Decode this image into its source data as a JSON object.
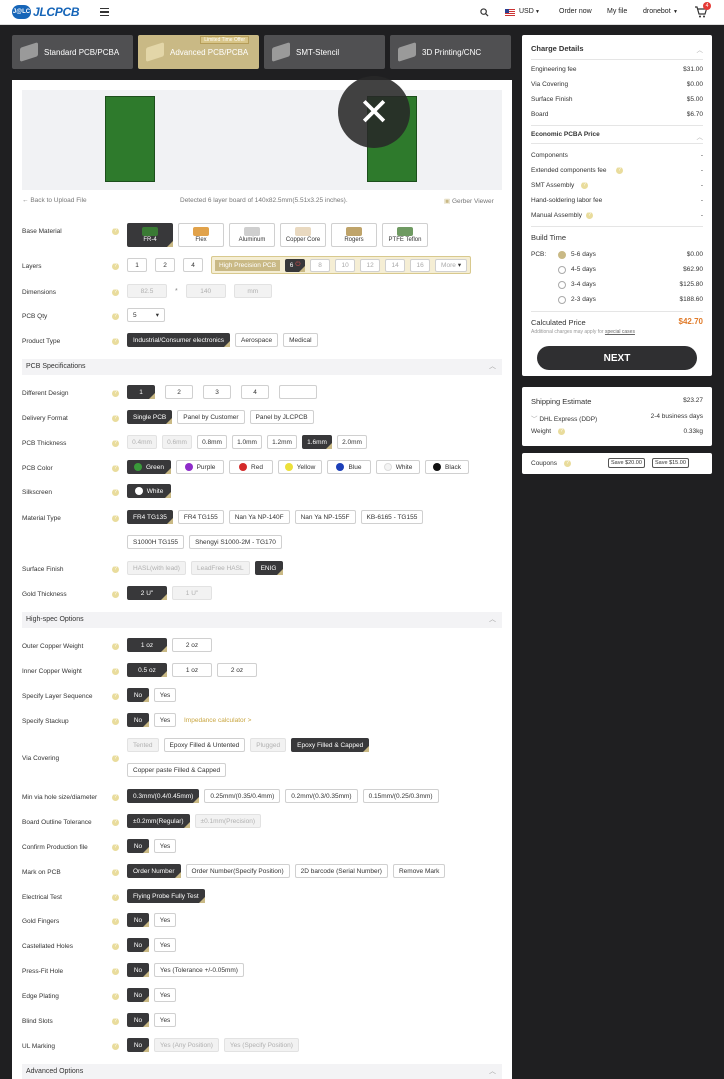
{
  "header": {
    "logo_badge": "J@LC",
    "logo_text": "JLCPCB",
    "currency": "USD",
    "order_now": "Order now",
    "my_file": "My file",
    "user": "dronebot",
    "cart_count": "4"
  },
  "tabs": [
    {
      "label": "Standard PCB/PCBA"
    },
    {
      "label": "Advanced PCB/PCBA",
      "badge": "Limited Time Offer"
    },
    {
      "label": "SMT-Stencil"
    },
    {
      "label": "3D Printing/CNC"
    }
  ],
  "preview": {
    "back": "Back to Upload File",
    "detected": "Detected 6 layer board of 140x82.5mm(5.51x3.25 inches).",
    "gerber": "Gerber Viewer",
    "close": "✕"
  },
  "base_material": {
    "label": "Base Material",
    "options": [
      "FR-4",
      "Flex",
      "Aluminum",
      "Copper Core",
      "Rogers",
      "PTFE Teflon"
    ]
  },
  "layers": {
    "label": "Layers",
    "options": [
      "1",
      "2",
      "4"
    ],
    "hp_label": "High Precision PCB",
    "hp_options": [
      "6",
      "8",
      "10",
      "12",
      "14",
      "16"
    ],
    "more": "More"
  },
  "dimensions": {
    "label": "Dimensions",
    "w": "82.5",
    "x": "*",
    "h": "140",
    "unit": "mm"
  },
  "pcb_qty": {
    "label": "PCB Qty",
    "value": "5"
  },
  "product_type": {
    "label": "Product Type",
    "options": [
      "Industrial/Consumer electronics",
      "Aerospace",
      "Medical"
    ]
  },
  "specs_section": "PCB Specifications",
  "different_design": {
    "label": "Different Design",
    "options": [
      "1",
      "2",
      "3",
      "4",
      ""
    ]
  },
  "delivery_format": {
    "label": "Delivery Format",
    "options": [
      "Single PCB",
      "Panel by Customer",
      "Panel by JLCPCB"
    ]
  },
  "pcb_thickness": {
    "label": "PCB Thickness",
    "options": [
      "0.4mm",
      "0.6mm",
      "0.8mm",
      "1.0mm",
      "1.2mm",
      "1.6mm",
      "2.0mm"
    ]
  },
  "pcb_color": {
    "label": "PCB Color",
    "options": [
      {
        "name": "Green",
        "color": "#3a9a3a"
      },
      {
        "name": "Purple",
        "color": "#8e2cc9"
      },
      {
        "name": "Red",
        "color": "#d42a2a"
      },
      {
        "name": "Yellow",
        "color": "#ece03a"
      },
      {
        "name": "Blue",
        "color": "#1c3fb8"
      },
      {
        "name": "White",
        "color": "#f4f4f4"
      },
      {
        "name": "Black",
        "color": "#111111"
      }
    ]
  },
  "silkscreen": {
    "label": "Silkscreen",
    "value": "White"
  },
  "material_type": {
    "label": "Material Type",
    "options": [
      "FR4 TG135",
      "FR4 TG155",
      "Nan Ya NP-140F",
      "Nan Ya NP-155F",
      "KB-6165 - TG155",
      "S1000H TG155",
      "Shengyi S1000-2M - TG170"
    ]
  },
  "surface_finish": {
    "label": "Surface Finish",
    "options": [
      "HASL(with lead)",
      "LeadFree HASL",
      "ENIG"
    ]
  },
  "gold_thickness": {
    "label": "Gold Thickness",
    "options": [
      "2 U\"",
      "1 U\""
    ]
  },
  "highspec_section": "High-spec Options",
  "outer_copper": {
    "label": "Outer Copper Weight",
    "options": [
      "1 oz",
      "2 oz"
    ]
  },
  "inner_copper": {
    "label": "Inner Copper Weight",
    "options": [
      "0.5 oz",
      "1 oz",
      "2 oz"
    ]
  },
  "layer_sequence": {
    "label": "Specify Layer Sequence",
    "options": [
      "No",
      "Yes"
    ]
  },
  "stackup": {
    "label": "Specify Stackup",
    "options": [
      "No",
      "Yes"
    ],
    "link": "Impedance calculator >"
  },
  "via_covering": {
    "label": "Via Covering",
    "options": [
      "Tented",
      "Epoxy Filled & Untented",
      "Plugged",
      "Epoxy Filled & Capped",
      "Copper paste Filled & Capped"
    ]
  },
  "min_via": {
    "label": "Min via hole size/diameter",
    "options": [
      "0.3mm/(0.4/0.45mm)",
      "0.25mm/(0.35/0.4mm)",
      "0.2mm/(0.3/0.35mm)",
      "0.15mm/(0.25/0.3mm)"
    ]
  },
  "outline_tol": {
    "label": "Board Outline Tolerance",
    "options": [
      "±0.2mm(Regular)",
      "±0.1mm(Precision)"
    ]
  },
  "confirm_file": {
    "label": "Confirm Production file",
    "options": [
      "No",
      "Yes"
    ]
  },
  "mark_pcb": {
    "label": "Mark on PCB",
    "options": [
      "Order Number",
      "Order Number(Specify Position)",
      "2D barcode (Serial Number)",
      "Remove Mark"
    ]
  },
  "electrical_test": {
    "label": "Electrical Test",
    "value": "Flying Probe Fully Test"
  },
  "gold_fingers": {
    "label": "Gold Fingers",
    "options": [
      "No",
      "Yes"
    ]
  },
  "castellated": {
    "label": "Castellated Holes",
    "options": [
      "No",
      "Yes"
    ]
  },
  "pressfit": {
    "label": "Press-Fit Hole",
    "options": [
      "No",
      "Yes (Tolerance +/-0.05mm)"
    ]
  },
  "edge_plating": {
    "label": "Edge Plating",
    "options": [
      "No",
      "Yes"
    ]
  },
  "blind_slots": {
    "label": "Blind Slots",
    "options": [
      "No",
      "Yes"
    ]
  },
  "ul_marking": {
    "label": "UL Marking",
    "options": [
      "No",
      "Yes (Any Position)",
      "Yes (Specify Position)"
    ]
  },
  "advanced_section": "Advanced Options",
  "charge": {
    "title": "Charge Details",
    "items": [
      {
        "label": "Engineering fee",
        "value": "$31.00"
      },
      {
        "label": "Via Covering",
        "value": "$0.00"
      },
      {
        "label": "Surface Finish",
        "value": "$5.00"
      },
      {
        "label": "Board",
        "value": "$6.70"
      }
    ],
    "pcba_title": "Economic PCBA Price",
    "pcba_items": [
      {
        "label": "Components",
        "value": "-"
      },
      {
        "label": "Extended components fee",
        "value": "-"
      },
      {
        "label": "SMT Assembly",
        "value": "-"
      },
      {
        "label": "Hand-soldering labor fee",
        "value": "-"
      },
      {
        "label": "Manual Assembly",
        "value": "-"
      }
    ],
    "build_title": "Build Time",
    "build_pcb": "PCB:",
    "build_items": [
      {
        "label": "5-6 days",
        "value": "$0.00"
      },
      {
        "label": "4-5 days",
        "value": "$62.90"
      },
      {
        "label": "3-4 days",
        "value": "$125.80"
      },
      {
        "label": "2-3 days",
        "value": "$188.60"
      }
    ],
    "calc_label": "Calculated Price",
    "calc_value": "$42.70",
    "calc_note": "Additional charges may apply for",
    "calc_link": "special cases",
    "next": "NEXT"
  },
  "shipping": {
    "title": "Shipping Estimate",
    "value": "$23.27",
    "method": "DHL Express (DDP)",
    "days": "2-4 business days",
    "weight_label": "Weight",
    "weight": "0.33kg"
  },
  "coupons": {
    "label": "Coupons",
    "c1": "Save $20.00",
    "c2": "Save $15.00"
  },
  "colors": {
    "accent": "#c9b985",
    "dark": "#38383a",
    "price": "#e07b2a"
  }
}
